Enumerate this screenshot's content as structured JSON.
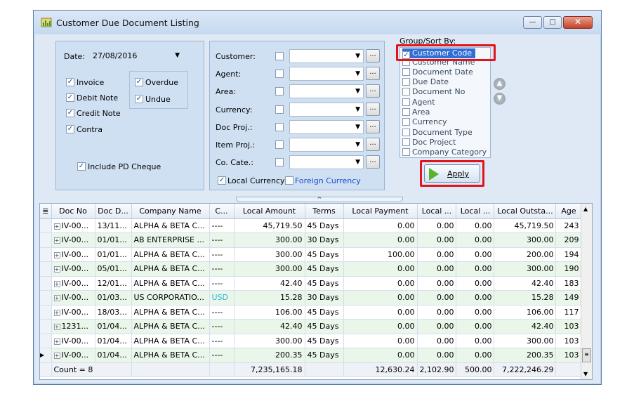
{
  "window": {
    "title": "Customer Due Document Listing",
    "min_glyph": "—",
    "max_glyph": "□",
    "close_glyph": "✕"
  },
  "left_panel": {
    "date_label": "Date:",
    "date_value": "27/08/2016",
    "doc_types": [
      "Invoice",
      "Debit Note",
      "Credit Note",
      "Contra"
    ],
    "due_status": [
      "Overdue",
      "Undue"
    ],
    "include_pd": "Include PD Cheque"
  },
  "filters": {
    "labels": [
      "Customer:",
      "Agent:",
      "Area:",
      "Currency:",
      "Doc Proj.:",
      "Item Proj.:",
      "Co. Cate.:"
    ],
    "ellipsis": "...",
    "local_currency": "Local Currency",
    "foreign_currency": "Foreign Currency"
  },
  "group_sort": {
    "label": "Group/Sort By:",
    "items": [
      "Customer Code",
      "Customer Name",
      "Document Date",
      "Due Date",
      "Document No",
      "Agent",
      "Area",
      "Currency",
      "Document Type",
      "Doc Project",
      "Company Category"
    ],
    "checked": "Customer Code",
    "apply": "Apply"
  },
  "grid": {
    "columns": [
      "Doc No",
      "Doc D...",
      "Company Name",
      "C...",
      "Local Amount",
      "Terms",
      "Local Payment",
      "Local ...",
      "Local ...",
      "Local Outsta...",
      "Age"
    ],
    "rows": [
      [
        "IV-00...",
        "13/11...",
        "ALPHA & BETA C...",
        "----",
        "45,719.50",
        "45 Days",
        "0.00",
        "0.00",
        "0.00",
        "45,719.50",
        "243"
      ],
      [
        "IV-00...",
        "01/01...",
        "AB ENTERPRISE ...",
        "----",
        "300.00",
        "30 Days",
        "0.00",
        "0.00",
        "0.00",
        "300.00",
        "209"
      ],
      [
        "IV-00...",
        "01/01...",
        "ALPHA & BETA C...",
        "----",
        "300.00",
        "45 Days",
        "100.00",
        "0.00",
        "0.00",
        "200.00",
        "194"
      ],
      [
        "IV-00...",
        "05/01...",
        "ALPHA & BETA C...",
        "----",
        "300.00",
        "45 Days",
        "0.00",
        "0.00",
        "0.00",
        "300.00",
        "190"
      ],
      [
        "IV-00...",
        "12/01...",
        "ALPHA & BETA C...",
        "----",
        "42.40",
        "45 Days",
        "0.00",
        "0.00",
        "0.00",
        "42.40",
        "183"
      ],
      [
        "IV-00...",
        "01/03...",
        "US CORPORATIO...",
        "USD",
        "15.28",
        "30 Days",
        "0.00",
        "0.00",
        "0.00",
        "15.28",
        "149"
      ],
      [
        "IV-00...",
        "18/03...",
        "ALPHA & BETA C...",
        "----",
        "106.00",
        "45 Days",
        "0.00",
        "0.00",
        "0.00",
        "106.00",
        "117"
      ],
      [
        "1231...",
        "01/04...",
        "ALPHA & BETA C...",
        "----",
        "42.40",
        "45 Days",
        "0.00",
        "0.00",
        "0.00",
        "42.40",
        "103"
      ],
      [
        "IV-00...",
        "01/04...",
        "ALPHA & BETA C...",
        "----",
        "300.00",
        "45 Days",
        "0.00",
        "0.00",
        "0.00",
        "300.00",
        "103"
      ],
      [
        "IV-00...",
        "01/04...",
        "ALPHA & BETA C...",
        "----",
        "200.35",
        "45 Days",
        "0.00",
        "0.00",
        "0.00",
        "200.35",
        "103"
      ]
    ],
    "footer": {
      "count": "Count = 8",
      "local_amount": "7,235,165.18",
      "local_payment": "12,630.24",
      "local_a": "2,102.90",
      "local_b": "500.00",
      "local_outstanding": "7,222,246.29"
    }
  },
  "colors": {
    "usd_accent": "#29b6d6",
    "highlight_red": "#e0141b",
    "selected_blue": "#2f6fd6"
  }
}
